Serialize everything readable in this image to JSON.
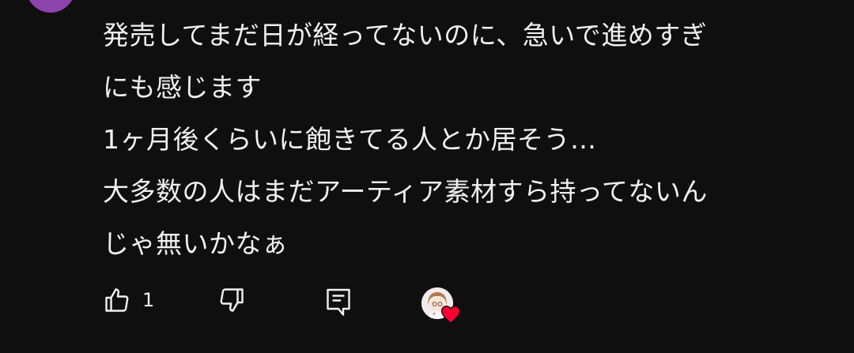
{
  "comment": {
    "lines": [
      "発売してまだ日が経ってないのに、急いで進めすぎ",
      "にも感じます",
      "1ヶ月後くらいに飽きてる人とか居そう…",
      "大多数の人はまだアーティア素材すら持ってないん",
      "じゃ無いかなぁ"
    ]
  },
  "actions": {
    "like_count": "1",
    "icons": {
      "like": "thumb-up-icon",
      "dislike": "thumb-down-icon",
      "reply": "reply-comment-icon",
      "heart": "heart-icon"
    }
  },
  "colors": {
    "background": "#0f0f0f",
    "text": "#f1f1f1",
    "heart": "#ff0033",
    "avatar": "#8e44ad"
  }
}
